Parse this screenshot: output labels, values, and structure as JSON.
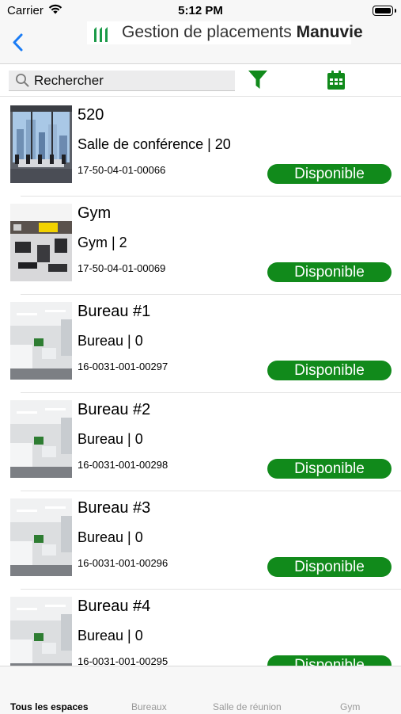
{
  "status_bar": {
    "carrier": "Carrier",
    "time": "5:12 PM"
  },
  "header": {
    "brand_prefix": "Gestion de placements",
    "brand_name": "Manuvie"
  },
  "search": {
    "placeholder": "Rechercher"
  },
  "icons": {
    "back": "chevron-left-icon",
    "search": "magnifying-glass-icon",
    "filter": "funnel-icon",
    "calendar": "calendar-icon"
  },
  "colors": {
    "accent": "#118a1b",
    "ios_blue": "#1a7cf5",
    "logo_green": "#1b9a48"
  },
  "spaces": [
    {
      "title": "520",
      "subtitle": "Salle de conférence | 20",
      "code": "17-50-04-01-00066",
      "status": "Disponible"
    },
    {
      "title": "Gym",
      "subtitle": "Gym | 2",
      "code": "17-50-04-01-00069",
      "status": "Disponible"
    },
    {
      "title": "Bureau #1",
      "subtitle": "Bureau | 0",
      "code": "16-0031-001-00297",
      "status": "Disponible"
    },
    {
      "title": "Bureau #2",
      "subtitle": "Bureau | 0",
      "code": "16-0031-001-00298",
      "status": "Disponible"
    },
    {
      "title": "Bureau #3",
      "subtitle": "Bureau | 0",
      "code": "16-0031-001-00296",
      "status": "Disponible"
    },
    {
      "title": "Bureau #4",
      "subtitle": "Bureau | 0",
      "code": "16-0031-001-00295",
      "status": "Disponible"
    }
  ],
  "tabs": [
    {
      "label": "Tous les espaces",
      "active": true
    },
    {
      "label": "Bureaux",
      "active": false
    },
    {
      "label": "Salle de réunion",
      "active": false
    },
    {
      "label": "Gym",
      "active": false
    }
  ]
}
